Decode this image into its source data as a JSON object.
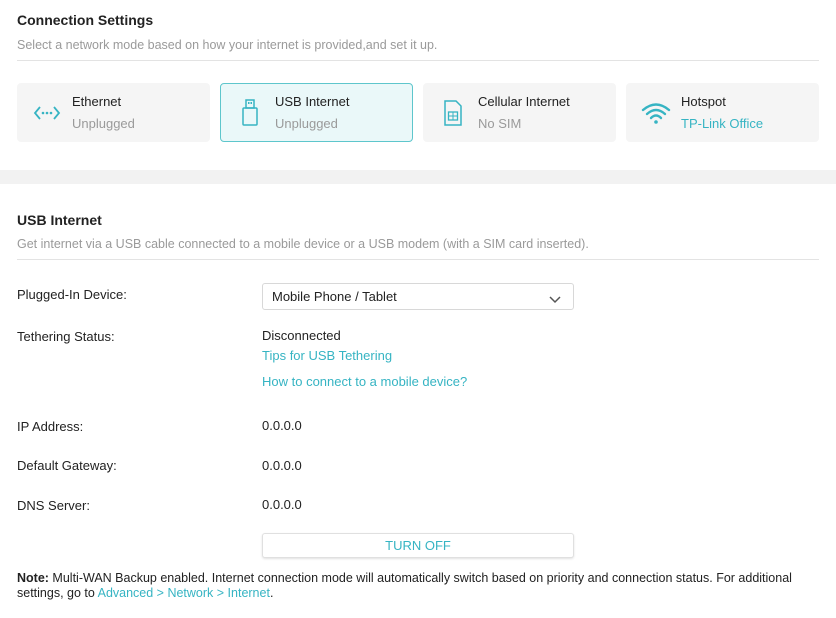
{
  "connection": {
    "title": "Connection Settings",
    "subtitle": "Select a network mode based on how your internet is provided,and set it up.",
    "cards": [
      {
        "name": "Ethernet",
        "status": "Unplugged"
      },
      {
        "name": "USB Internet",
        "status": "Unplugged"
      },
      {
        "name": "Cellular Internet",
        "status": "No SIM"
      },
      {
        "name": "Hotspot",
        "status": "TP-Link Office"
      }
    ]
  },
  "usb": {
    "title": "USB Internet",
    "subtitle": "Get internet via a USB cable connected to a mobile device or a USB modem (with a SIM card inserted).",
    "plugged_label": "Plugged-In Device:",
    "plugged_value": "Mobile Phone / Tablet",
    "tethering_label": "Tethering Status:",
    "tethering_value": "Disconnected",
    "tips_link": "Tips for USB Tethering",
    "howto_link": "How to connect to a mobile device?",
    "ip_label": "IP Address:",
    "ip_value": "0.0.0.0",
    "gateway_label": "Default Gateway:",
    "gateway_value": "0.0.0.0",
    "dns_label": "DNS Server:",
    "dns_value": "0.0.0.0",
    "turn_off": "TURN OFF"
  },
  "note": {
    "prefix": "Note:",
    "text": " Multi-WAN Backup enabled. Internet connection mode will automatically switch based on priority and connection status. For additional settings, go to ",
    "link": "Advanced > Network > Internet",
    "suffix": "."
  },
  "colors": {
    "accent": "#36b4c3",
    "muted": "#9a9a9a",
    "active_bg": "#eaf8f9"
  }
}
